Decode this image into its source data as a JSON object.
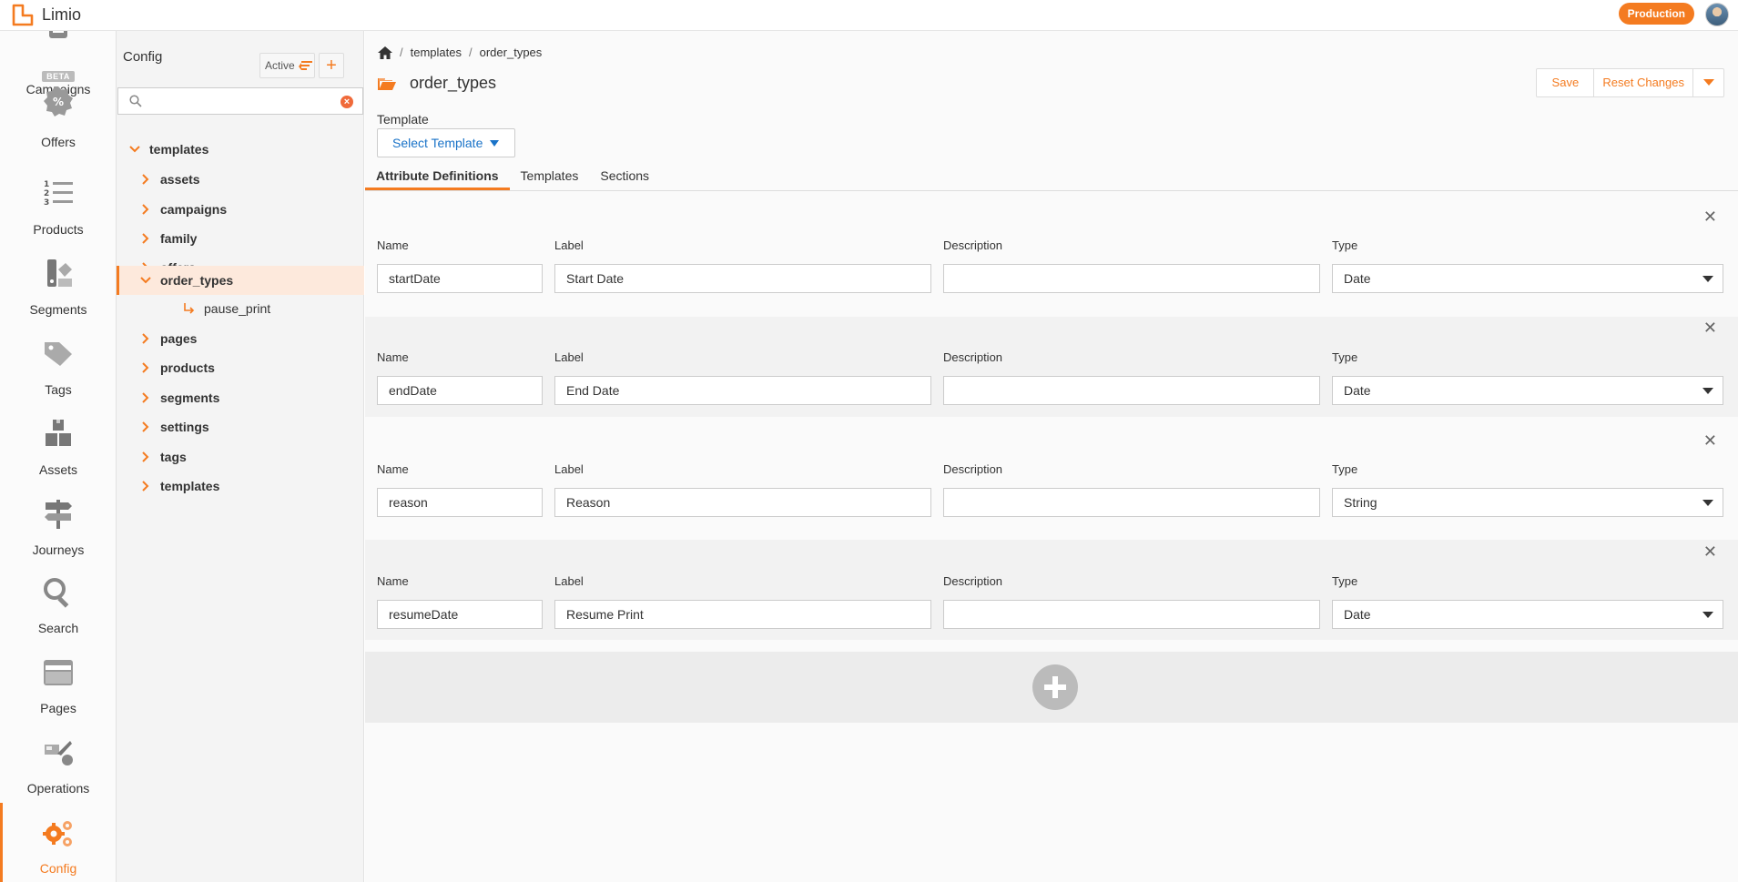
{
  "app": {
    "name": "Limio",
    "environment": "Production"
  },
  "nav": {
    "items": [
      {
        "key": "campaigns",
        "label": "Campaigns"
      },
      {
        "key": "offers",
        "label": "Offers",
        "badge": "BETA"
      },
      {
        "key": "products",
        "label": "Products"
      },
      {
        "key": "segments",
        "label": "Segments"
      },
      {
        "key": "tags",
        "label": "Tags"
      },
      {
        "key": "assets",
        "label": "Assets"
      },
      {
        "key": "journeys",
        "label": "Journeys"
      },
      {
        "key": "search",
        "label": "Search"
      },
      {
        "key": "pages",
        "label": "Pages"
      },
      {
        "key": "operations",
        "label": "Operations"
      },
      {
        "key": "config",
        "label": "Config",
        "active": true
      }
    ]
  },
  "tree": {
    "title": "Config",
    "filter_label": "Active",
    "add_label": "+",
    "search": {
      "value": "",
      "placeholder": ""
    },
    "root": "templates",
    "items": [
      {
        "label": "assets"
      },
      {
        "label": "campaigns"
      },
      {
        "label": "family"
      },
      {
        "label": "offers"
      },
      {
        "label": "order_types",
        "expanded": true,
        "selected": true
      },
      {
        "label": "pause_print",
        "child": true
      },
      {
        "label": "pages"
      },
      {
        "label": "products"
      },
      {
        "label": "segments"
      },
      {
        "label": "settings"
      },
      {
        "label": "tags"
      },
      {
        "label": "templates"
      }
    ]
  },
  "main": {
    "breadcrumb": [
      "templates",
      "order_types"
    ],
    "title": "order_types",
    "actions": {
      "save": "Save",
      "reset": "Reset Changes"
    },
    "template_label": "Template",
    "template_select": "Select Template",
    "tabs": [
      {
        "label": "Attribute Definitions",
        "active": true
      },
      {
        "label": "Templates"
      },
      {
        "label": "Sections"
      }
    ],
    "field_labels": {
      "name": "Name",
      "label": "Label",
      "description": "Description",
      "type": "Type"
    },
    "attributes": [
      {
        "name": "startDate",
        "label": "Start Date",
        "description": "",
        "type": "Date"
      },
      {
        "name": "endDate",
        "label": "End Date",
        "description": "",
        "type": "Date"
      },
      {
        "name": "reason",
        "label": "Reason",
        "description": "",
        "type": "String"
      },
      {
        "name": "resumeDate",
        "label": "Resume Print",
        "description": "",
        "type": "Date"
      }
    ]
  },
  "colors": {
    "accent": "#f47b20",
    "link": "#1a73c8"
  }
}
